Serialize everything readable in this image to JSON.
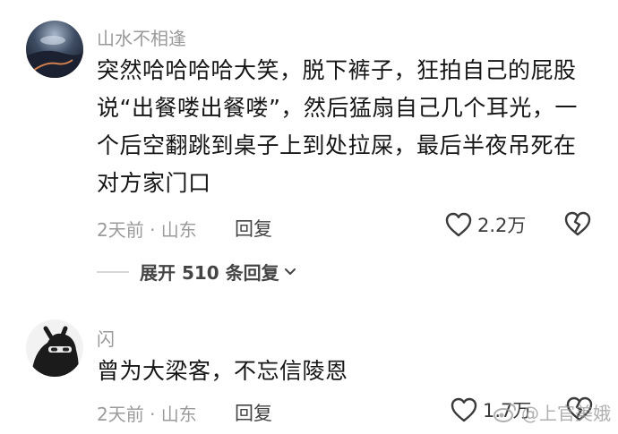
{
  "comments": [
    {
      "username": "山水不相逢",
      "text": "突然哈哈哈哈大笑，脱下裤子，狂拍自己的屁股说“出餐喽出餐喽”，然后猛扇自己几个耳光，一个后空翻跳到桌子上到处拉屎，最后半夜吊死在对方家门口",
      "meta": "2天前 · 山东",
      "reply_label": "回复",
      "likes": "2.2万",
      "expand_label": "展开 510 条回复"
    },
    {
      "username": "闪",
      "text": "曾为大梁客，不忘信陵恩",
      "meta": "2天前 · 山东",
      "reply_label": "回复",
      "likes": "1.7万"
    }
  ],
  "watermark": "@上官美娥",
  "colors": {
    "text_primary": "#161616",
    "text_secondary": "#9a9a9a"
  },
  "icons": {
    "like": "heart-outline-icon",
    "dislike": "broken-heart-icon",
    "expand": "chevron-down-icon"
  }
}
